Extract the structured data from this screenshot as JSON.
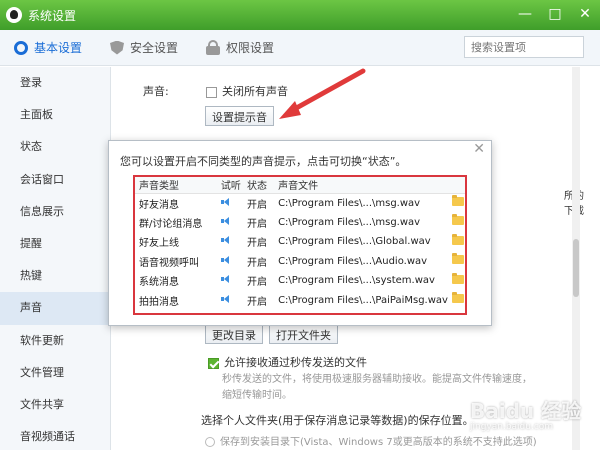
{
  "window": {
    "title": "系统设置",
    "controls": [
      "—",
      "□",
      "✕"
    ]
  },
  "tabs": [
    {
      "label": "基本设置",
      "icon": "gear-icon"
    },
    {
      "label": "安全设置",
      "icon": "shield-icon"
    },
    {
      "label": "权限设置",
      "icon": "lock-icon"
    }
  ],
  "search": {
    "placeholder": "搜索设置项"
  },
  "sidebar": {
    "items": [
      "登录",
      "主面板",
      "状态",
      "会话窗口",
      "信息展示",
      "提醒",
      "热键",
      "声音",
      "软件更新",
      "文件管理",
      "文件共享",
      "音视频通话"
    ],
    "active": "声音"
  },
  "content": {
    "sound_label": "声音:",
    "mute_all": "关闭所有声音",
    "set_tone_button": "设置提示音",
    "partial_text_1": "所的下载",
    "partial_text_2": "",
    "change_dir_button": "更改目录",
    "open_folder_button": "打开文件夹",
    "allow_receive": "允许接收通过秒传发送的文件",
    "allow_desc": "秒传发送的文件，将使用极速服务器辅助接收。能提高文件传输速度，缩短传输时间。",
    "choose_folder": "选择个人文件夹(用于保存消息记录等数据)的保存位置。",
    "save_install": "保存到安装目录下(Vista、Windows 7或更高版本的系统不支持此选项)"
  },
  "dialog": {
    "hint": "您可以设置开启不同类型的声音提示，点击可切换“状态”。",
    "columns": [
      "声音类型",
      "试听",
      "状态",
      "声音文件"
    ],
    "rows": [
      {
        "type": "好友消息",
        "status": "开启",
        "file": "C:\\Program Files\\...\\msg.wav"
      },
      {
        "type": "群/讨论组消息",
        "status": "开启",
        "file": "C:\\Program Files\\...\\msg.wav"
      },
      {
        "type": "好友上线",
        "status": "开启",
        "file": "C:\\Program Files\\...\\Global.wav"
      },
      {
        "type": "语音视频呼叫",
        "status": "开启",
        "file": "C:\\Program Files\\...\\Audio.wav"
      },
      {
        "type": "系统消息",
        "status": "开启",
        "file": "C:\\Program Files\\...\\system.wav"
      },
      {
        "type": "拍拍消息",
        "status": "开启",
        "file": "C:\\Program Files\\...\\PaiPaiMsg.wav"
      }
    ]
  },
  "watermark": {
    "main": "Baidu 经验",
    "sub": "jingyan.baidu.com"
  },
  "colors": {
    "titlebar": "#4faf33",
    "accent": "#1a6dd6",
    "highlight": "#d9363e"
  }
}
